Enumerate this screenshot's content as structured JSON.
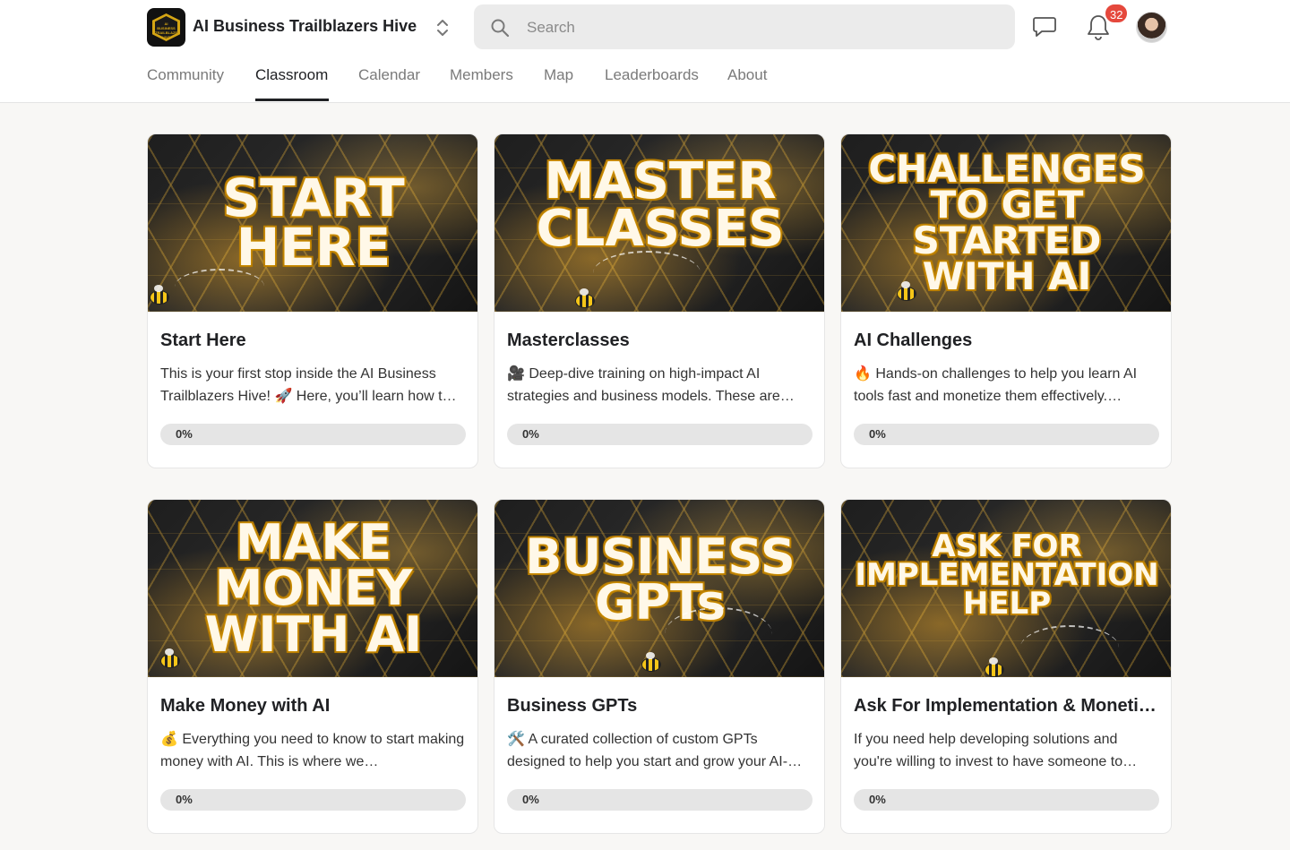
{
  "header": {
    "group_name": "AI Business Trailblazers Hive",
    "logo_text": "AI BUSINESS TRAILBLAZERS HIVE",
    "search_placeholder": "Search",
    "notification_count": "32"
  },
  "nav": {
    "tabs": [
      {
        "label": "Community",
        "active": false
      },
      {
        "label": "Classroom",
        "active": true
      },
      {
        "label": "Calendar",
        "active": false
      },
      {
        "label": "Members",
        "active": false
      },
      {
        "label": "Map",
        "active": false
      },
      {
        "label": "Leaderboards",
        "active": false
      },
      {
        "label": "About",
        "active": false
      }
    ]
  },
  "courses": [
    {
      "thumb_lines": [
        "START",
        "HERE"
      ],
      "title": "Start Here",
      "description": "This is your first stop inside the AI Business Trailblazers Hive! 🚀 Here, you’ll learn how t…",
      "progress_label": "0%",
      "progress": 0
    },
    {
      "thumb_lines": [
        "MASTER",
        "CLASSES"
      ],
      "title": "Masterclasses",
      "description": "🎥 Deep-dive training on high-impact AI strategies and business models. These are…",
      "progress_label": "0%",
      "progress": 0
    },
    {
      "thumb_lines": [
        "CHALLENGES",
        "TO GET",
        "STARTED",
        "WITH AI"
      ],
      "title": "AI Challenges",
      "description": "🔥 Hands-on challenges to help you learn AI tools fast and monetize them effectively.…",
      "progress_label": "0%",
      "progress": 0
    },
    {
      "thumb_lines": [
        "MAKE",
        "MONEY",
        "WITH AI"
      ],
      "title": "Make Money with AI",
      "description": "💰 Everything you need to know to start making money with AI. This is where we…",
      "progress_label": "0%",
      "progress": 0
    },
    {
      "thumb_lines": [
        "BUSINESS",
        "GPTs"
      ],
      "title": "Business GPTs",
      "description": "🛠️ A curated collection of custom GPTs designed to help you start and grow your AI-…",
      "progress_label": "0%",
      "progress": 0
    },
    {
      "thumb_lines": [
        "ASK FOR",
        "IMPLEMENTATION",
        "HELP"
      ],
      "title": "Ask For Implementation & Moneti…",
      "description": "If you need help developing solutions and you're willing to invest to have someone to…",
      "progress_label": "0%",
      "progress": 0
    }
  ],
  "colors": {
    "accent": "#202124",
    "badge": "#e5483c",
    "progress_track": "#e5e5e5",
    "thumb_glow": "#e3a20b"
  }
}
